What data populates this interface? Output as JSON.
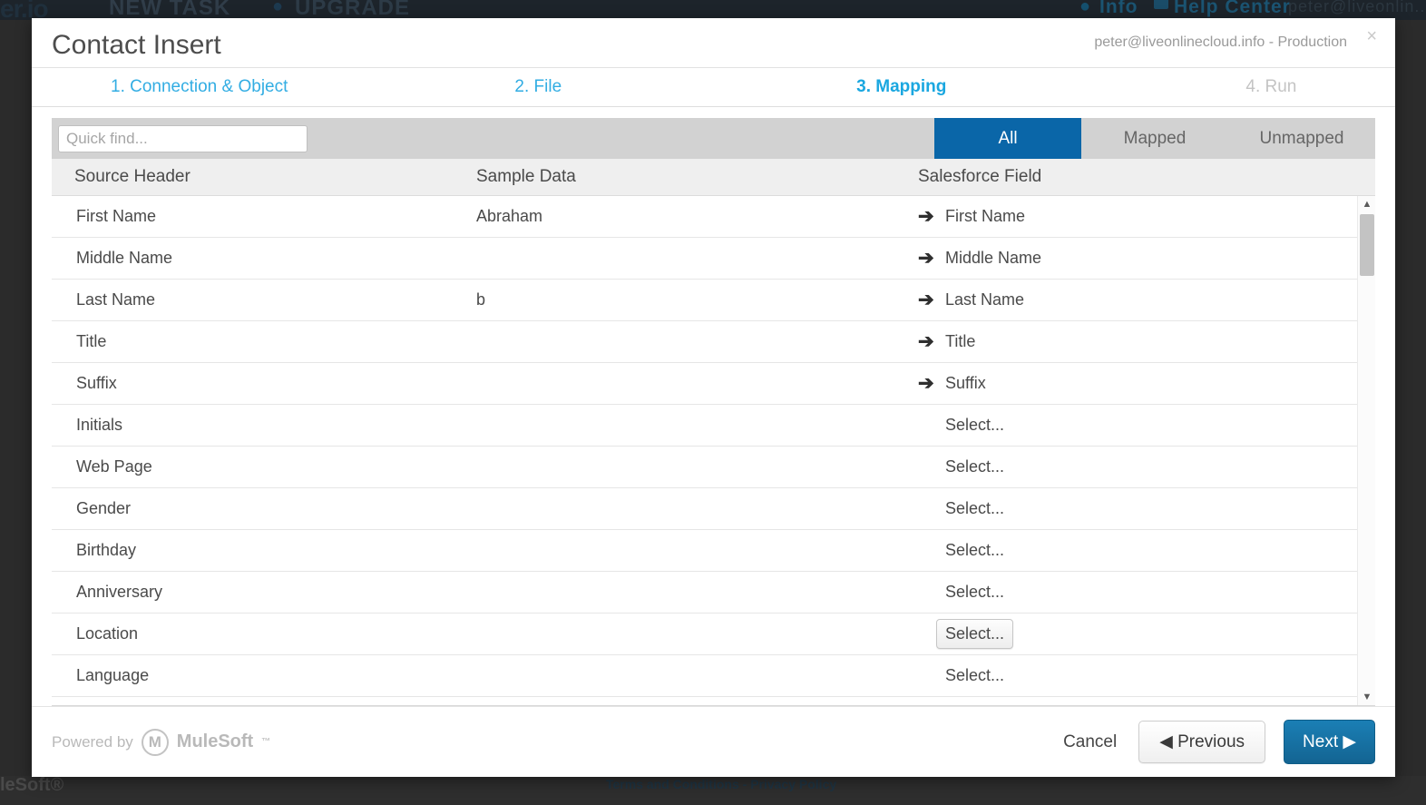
{
  "background": {
    "logo": "er.io",
    "logo_accent": ".io",
    "new_task": "NEW TASK",
    "upgrade": "UPGRADE",
    "upgrade_icon": "upgrade-icon",
    "info": "Info",
    "info_icon": "info-icon",
    "help_center": "Help Center",
    "help_icon": "help-icon",
    "user": "peter@liveonlin...",
    "mulesoft_mark": "leSoft®",
    "terms": "Terms and Conditions - Privacy Policy",
    "bar_color": "#1d242b",
    "overlay_color": "#2b2b2b"
  },
  "modal": {
    "title": "Contact Insert",
    "account": "peter@liveonlinecloud.info - Production",
    "close_label": "×",
    "steps": [
      {
        "label": "1. Connection & Object",
        "active": false
      },
      {
        "label": "2. File",
        "active": false
      },
      {
        "label": "3. Mapping",
        "active": true
      },
      {
        "label": "4. Run",
        "active": false,
        "disabled": true
      }
    ],
    "accent_color": "#1aa7e0",
    "primary_color": "#0a66a8"
  },
  "filter_bar": {
    "search_placeholder": "Quick find...",
    "search_value": "",
    "segments": [
      {
        "label": "All",
        "active": true
      },
      {
        "label": "Mapped",
        "active": false
      },
      {
        "label": "Unmapped",
        "active": false
      }
    ]
  },
  "table": {
    "columns": [
      "Source Header",
      "Sample Data",
      "Salesforce Field"
    ],
    "select_placeholder": "Select...",
    "arrow_glyph": "➔",
    "rows": [
      {
        "source": "First Name",
        "sample": "Abraham",
        "mapped": true,
        "salesforce": "First Name",
        "hovered": false
      },
      {
        "source": "Middle Name",
        "sample": "",
        "mapped": true,
        "salesforce": "Middle Name",
        "hovered": false
      },
      {
        "source": "Last Name",
        "sample": "b",
        "mapped": true,
        "salesforce": "Last Name",
        "hovered": false
      },
      {
        "source": "Title",
        "sample": "",
        "mapped": true,
        "salesforce": "Title",
        "hovered": false
      },
      {
        "source": "Suffix",
        "sample": "",
        "mapped": true,
        "salesforce": "Suffix",
        "hovered": false
      },
      {
        "source": "Initials",
        "sample": "",
        "mapped": false,
        "salesforce": "Select...",
        "hovered": false
      },
      {
        "source": "Web Page",
        "sample": "",
        "mapped": false,
        "salesforce": "Select...",
        "hovered": false
      },
      {
        "source": "Gender",
        "sample": "",
        "mapped": false,
        "salesforce": "Select...",
        "hovered": false
      },
      {
        "source": "Birthday",
        "sample": "",
        "mapped": false,
        "salesforce": "Select...",
        "hovered": false
      },
      {
        "source": "Anniversary",
        "sample": "",
        "mapped": false,
        "salesforce": "Select...",
        "hovered": false
      },
      {
        "source": "Location",
        "sample": "",
        "mapped": false,
        "salesforce": "Select...",
        "hovered": true
      },
      {
        "source": "Language",
        "sample": "",
        "mapped": false,
        "salesforce": "Select...",
        "hovered": false
      }
    ],
    "scroll_up_glyph": "▲",
    "scroll_down_glyph": "▼"
  },
  "footer": {
    "powered_by": "Powered by",
    "brand": "MuleSoft",
    "brand_mark": "M",
    "brand_tm": "™",
    "cancel": "Cancel",
    "previous": "◀ Previous",
    "next": "Next ▶"
  }
}
